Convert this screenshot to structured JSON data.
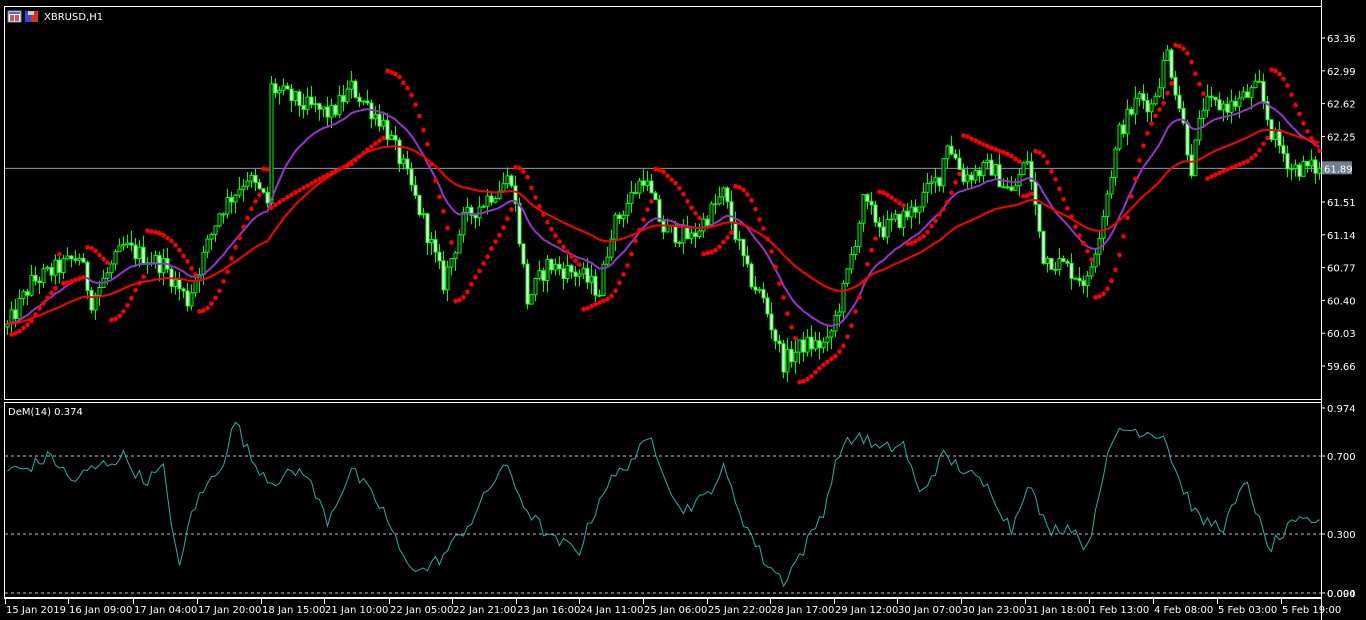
{
  "window": {
    "symbol_title": "XBRUSD,H1"
  },
  "indicator": {
    "label": "DeM(14) 0.374"
  },
  "colors": {
    "background": "#000000",
    "candle": "#00ff00",
    "bear_body": "#ffffff",
    "sar": "#ff0000",
    "ma_fast": "#9932cc",
    "ma_slow": "#ff0000",
    "dem_line": "#20b2aa",
    "price_label_bg": "#708090",
    "grid": "#c0c0c0"
  },
  "chart_data": {
    "type": "candlestick",
    "symbol": "XBRUSD",
    "timeframe": "H1",
    "current_price": "61.89",
    "price_ticks": [
      "63.36",
      "62.99",
      "62.62",
      "62.25",
      "61.51",
      "61.14",
      "60.77",
      "60.40",
      "60.03",
      "59.66"
    ],
    "price_range": [
      59.4,
      63.75
    ],
    "time_labels": [
      "15 Jan 2019",
      "16 Jan 09:00",
      "17 Jan 04:00",
      "17 Jan 20:00",
      "18 Jan 15:00",
      "21 Jan 10:00",
      "22 Jan 05:00",
      "22 Jan 21:00",
      "23 Jan 16:00",
      "24 Jan 11:00",
      "25 Jan 06:00",
      "25 Jan 22:00",
      "28 Jan 17:00",
      "29 Jan 12:00",
      "30 Jan 07:00",
      "30 Jan 23:00",
      "31 Jan 18:00",
      "1 Feb 13:00",
      "4 Feb 08:00",
      "5 Feb 03:00",
      "5 Feb 19:00"
    ],
    "bar_count": 329,
    "close_waypoints": [
      [
        0,
        60.1
      ],
      [
        6,
        60.6
      ],
      [
        18,
        60.9
      ],
      [
        21,
        60.4
      ],
      [
        29,
        61.0
      ],
      [
        39,
        60.8
      ],
      [
        45,
        60.4
      ],
      [
        53,
        61.4
      ],
      [
        60,
        61.8
      ],
      [
        65,
        61.5
      ],
      [
        66,
        62.8
      ],
      [
        74,
        62.6
      ],
      [
        81,
        62.5
      ],
      [
        86,
        62.8
      ],
      [
        94,
        62.4
      ],
      [
        99,
        61.9
      ],
      [
        104,
        61.3
      ],
      [
        109,
        60.6
      ],
      [
        114,
        61.3
      ],
      [
        121,
        61.6
      ],
      [
        126,
        61.8
      ],
      [
        130,
        60.4
      ],
      [
        135,
        60.8
      ],
      [
        143,
        60.7
      ],
      [
        148,
        60.5
      ],
      [
        151,
        61.2
      ],
      [
        159,
        61.8
      ],
      [
        164,
        61.2
      ],
      [
        171,
        61.1
      ],
      [
        179,
        61.6
      ],
      [
        185,
        60.7
      ],
      [
        189,
        60.4
      ],
      [
        194,
        59.7
      ],
      [
        199,
        59.9
      ],
      [
        205,
        59.9
      ],
      [
        209,
        60.5
      ],
      [
        214,
        61.5
      ],
      [
        219,
        61.2
      ],
      [
        226,
        61.4
      ],
      [
        233,
        61.8
      ],
      [
        235,
        62.2
      ],
      [
        239,
        61.8
      ],
      [
        246,
        61.9
      ],
      [
        251,
        61.6
      ],
      [
        255,
        62.0
      ],
      [
        259,
        60.9
      ],
      [
        264,
        60.8
      ],
      [
        270,
        60.6
      ],
      [
        274,
        61.4
      ],
      [
        278,
        62.3
      ],
      [
        283,
        62.7
      ],
      [
        286,
        62.6
      ],
      [
        290,
        63.2
      ],
      [
        293,
        62.6
      ],
      [
        296,
        61.9
      ],
      [
        299,
        62.6
      ],
      [
        306,
        62.6
      ],
      [
        313,
        62.8
      ],
      [
        316,
        62.3
      ],
      [
        321,
        61.9
      ],
      [
        328,
        61.89
      ]
    ],
    "overlays": [
      "Parabolic SAR",
      "Moving Average (fast)",
      "Moving Average (slow)"
    ],
    "indicator": {
      "name": "DeM(14)",
      "last_value": 0.374,
      "ticks": [
        "0.974",
        "0.700",
        "0.300",
        "0.094",
        "0.000"
      ],
      "levels": [
        0.7,
        0.3
      ],
      "range": [
        0.0,
        1.0
      ],
      "waypoints": [
        [
          0,
          0.63
        ],
        [
          4,
          0.63
        ],
        [
          11,
          0.7
        ],
        [
          16,
          0.57
        ],
        [
          21,
          0.63
        ],
        [
          29,
          0.7
        ],
        [
          34,
          0.57
        ],
        [
          39,
          0.63
        ],
        [
          43,
          0.11
        ],
        [
          46,
          0.42
        ],
        [
          54,
          0.68
        ],
        [
          57,
          0.88
        ],
        [
          61,
          0.68
        ],
        [
          66,
          0.57
        ],
        [
          74,
          0.63
        ],
        [
          80,
          0.37
        ],
        [
          86,
          0.63
        ],
        [
          94,
          0.42
        ],
        [
          99,
          0.17
        ],
        [
          104,
          0.11
        ],
        [
          109,
          0.19
        ],
        [
          116,
          0.37
        ],
        [
          124,
          0.66
        ],
        [
          130,
          0.42
        ],
        [
          136,
          0.27
        ],
        [
          143,
          0.22
        ],
        [
          149,
          0.53
        ],
        [
          155,
          0.66
        ],
        [
          161,
          0.79
        ],
        [
          168,
          0.42
        ],
        [
          174,
          0.48
        ],
        [
          179,
          0.63
        ],
        [
          184,
          0.37
        ],
        [
          189,
          0.17
        ],
        [
          194,
          0.06
        ],
        [
          199,
          0.22
        ],
        [
          204,
          0.42
        ],
        [
          208,
          0.73
        ],
        [
          213,
          0.81
        ],
        [
          218,
          0.73
        ],
        [
          224,
          0.76
        ],
        [
          228,
          0.5
        ],
        [
          234,
          0.7
        ],
        [
          239,
          0.63
        ],
        [
          246,
          0.52
        ],
        [
          251,
          0.32
        ],
        [
          255,
          0.57
        ],
        [
          260,
          0.32
        ],
        [
          266,
          0.34
        ],
        [
          270,
          0.22
        ],
        [
          274,
          0.63
        ],
        [
          278,
          0.84
        ],
        [
          283,
          0.83
        ],
        [
          289,
          0.81
        ],
        [
          293,
          0.57
        ],
        [
          298,
          0.37
        ],
        [
          304,
          0.34
        ],
        [
          310,
          0.57
        ],
        [
          315,
          0.22
        ],
        [
          321,
          0.34
        ],
        [
          325,
          0.37
        ],
        [
          328,
          0.374
        ]
      ]
    }
  }
}
